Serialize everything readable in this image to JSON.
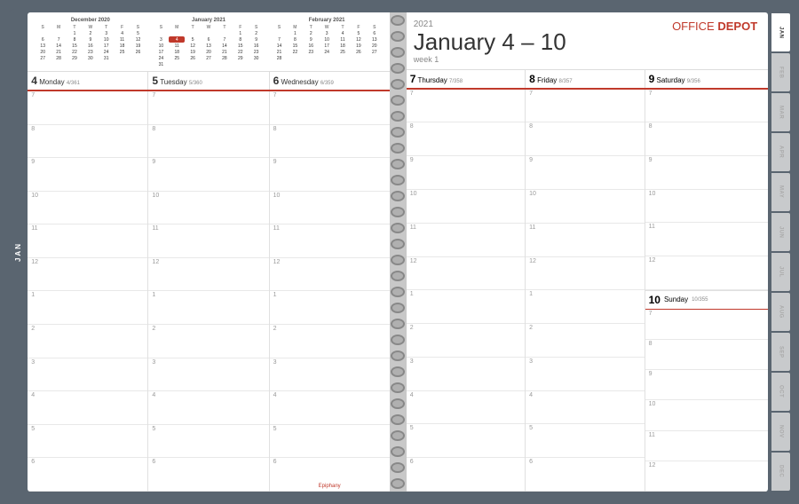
{
  "brand": {
    "office": "Office",
    "depot": "DEPOT"
  },
  "year": "2021",
  "week_title": "January 4 – 10",
  "week_num": "week 1",
  "mini_calendars": [
    {
      "title": "December 2020",
      "headers": [
        "S",
        "M",
        "T",
        "W",
        "T",
        "F",
        "S"
      ],
      "rows": [
        [
          "",
          "",
          "1",
          "2",
          "3",
          "4",
          "5"
        ],
        [
          "6",
          "7",
          "8",
          "9",
          "10",
          "11",
          "12"
        ],
        [
          "13",
          "14",
          "15",
          "16",
          "17",
          "18",
          "19"
        ],
        [
          "20",
          "21",
          "22",
          "23",
          "24",
          "25",
          "26"
        ],
        [
          "27",
          "28",
          "29",
          "30",
          "31",
          "",
          ""
        ]
      ]
    },
    {
      "title": "January 2021",
      "headers": [
        "S",
        "M",
        "T",
        "W",
        "T",
        "F",
        "S"
      ],
      "rows": [
        [
          "",
          "",
          "",
          "",
          "",
          "1",
          "2"
        ],
        [
          "3",
          "4",
          "5",
          "6",
          "7",
          "8",
          "9"
        ],
        [
          "10",
          "11",
          "12",
          "13",
          "14",
          "15",
          "16"
        ],
        [
          "17",
          "18",
          "19",
          "20",
          "21",
          "22",
          "23"
        ],
        [
          "24",
          "25",
          "26",
          "27",
          "28",
          "29",
          "30"
        ],
        [
          "31",
          "",
          "",
          "",
          "",
          "",
          ""
        ]
      ],
      "highlight": "4"
    },
    {
      "title": "February 2021",
      "headers": [
        "S",
        "M",
        "T",
        "W",
        "T",
        "F",
        "S"
      ],
      "rows": [
        [
          "",
          "1",
          "2",
          "3",
          "4",
          "5",
          "6"
        ],
        [
          "7",
          "8",
          "9",
          "10",
          "11",
          "12",
          "13"
        ],
        [
          "14",
          "15",
          "16",
          "17",
          "18",
          "19",
          "20"
        ],
        [
          "21",
          "22",
          "23",
          "24",
          "25",
          "26",
          "27"
        ],
        [
          "28",
          "",
          "",
          "",
          "",
          "",
          ""
        ]
      ]
    }
  ],
  "left_days": [
    {
      "num": "4",
      "name": "Monday",
      "code": "4/361"
    },
    {
      "num": "5",
      "name": "Tuesday",
      "code": "5/360"
    },
    {
      "num": "6",
      "name": "Wednesday",
      "code": "6/359"
    }
  ],
  "right_days": [
    {
      "num": "7",
      "name": "Thursday",
      "code": "7/358"
    },
    {
      "num": "8",
      "name": "Friday",
      "code": "8/357"
    },
    {
      "num": "9",
      "name": "Saturday",
      "code": "9/356"
    },
    {
      "num": "10",
      "name": "Sunday",
      "code": "10/355"
    }
  ],
  "time_slots": [
    "7",
    "8",
    "9",
    "10",
    "11",
    "12",
    "1",
    "2",
    "3",
    "4",
    "5",
    "6"
  ],
  "jan_label": "JAN",
  "tabs": [
    "FEB",
    "MAR",
    "APR",
    "MAY",
    "JUN",
    "JUL",
    "AUG",
    "SEP",
    "OCT",
    "NOV",
    "DEC"
  ],
  "footnote": "Epiphany"
}
